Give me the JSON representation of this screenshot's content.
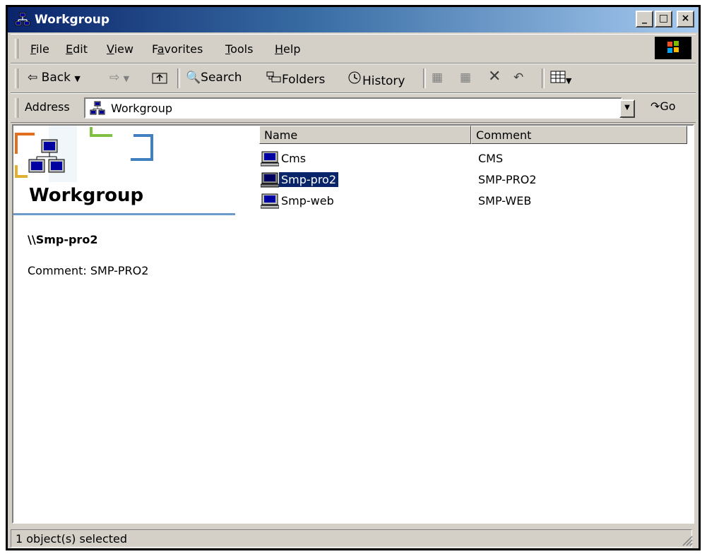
{
  "window": {
    "title": "Workgroup"
  },
  "caption_buttons": {
    "minimize": "_",
    "maximize": "□",
    "close": "×"
  },
  "menu": [
    {
      "key": "F",
      "rest": "ile"
    },
    {
      "key": "E",
      "rest": "dit",
      "plain": true
    },
    {
      "key": "V",
      "rest": "iew"
    },
    {
      "pre": "F",
      "key": "a",
      "rest": "vorites"
    },
    {
      "key": "T",
      "rest": "ools"
    },
    {
      "key": "H",
      "rest": "elp"
    }
  ],
  "menu_labels": [
    "File",
    "Edit",
    "View",
    "Favorites",
    "Tools",
    "Help"
  ],
  "toolbar": {
    "back": "Back",
    "search": "Search",
    "folders": "Folders",
    "history": "History"
  },
  "address": {
    "label": "Address",
    "value": "Workgroup",
    "go": "Go"
  },
  "left_pane": {
    "title": "Workgroup",
    "selected_name": "\\\\Smp-pro2",
    "selected_comment": "Comment: SMP-PRO2"
  },
  "list": {
    "columns": [
      "Name",
      "Comment"
    ],
    "rows": [
      {
        "name": "Cms",
        "comment": "CMS",
        "selected": false
      },
      {
        "name": "Smp-pro2",
        "comment": "SMP-PRO2",
        "selected": true
      },
      {
        "name": "Smp-web",
        "comment": "SMP-WEB",
        "selected": false
      }
    ]
  },
  "status": {
    "text": "1 object(s) selected"
  },
  "colors": {
    "selection": "#0a246a",
    "titlebar_start": "#0a246a",
    "titlebar_end": "#a6caf0",
    "face": "#d4d0c8"
  },
  "icons": [
    "network-icon",
    "computer-icon",
    "back-arrow-icon",
    "forward-arrow-icon",
    "up-folder-icon",
    "search-icon",
    "folders-icon",
    "history-icon",
    "move-to-icon",
    "copy-to-icon",
    "delete-icon",
    "undo-icon",
    "views-icon",
    "windows-logo-icon",
    "go-arrow-icon"
  ]
}
